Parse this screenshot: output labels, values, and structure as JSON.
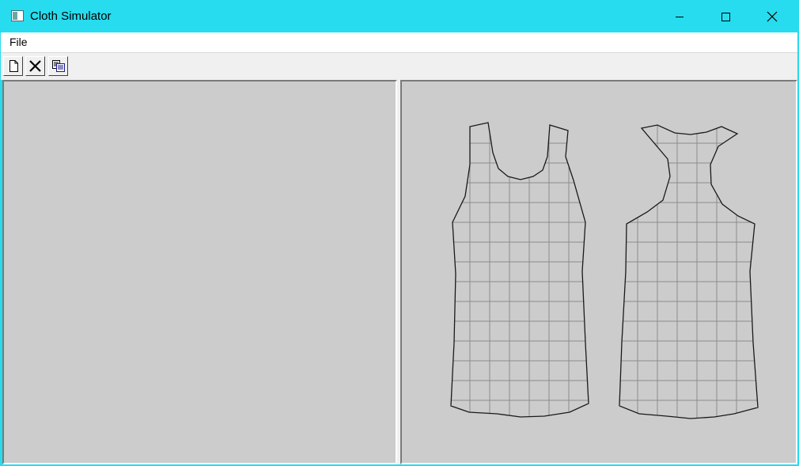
{
  "window": {
    "title": "Cloth Simulator",
    "icon": "app-window-icon"
  },
  "titlebar_buttons": [
    "minimize-icon",
    "maximize-icon",
    "close-icon"
  ],
  "menu": {
    "items": [
      "File"
    ]
  },
  "toolbar": {
    "buttons": [
      "new-document-icon",
      "delete-icon",
      "copy-icon"
    ]
  },
  "pattern_view": {
    "pieces": [
      "front-panel",
      "back-panel"
    ]
  },
  "colors": {
    "titlebar": "#27dcee",
    "viewport": "#cccccc",
    "grid_line": "#8c8c8c",
    "outline": "#1a1a1a"
  }
}
